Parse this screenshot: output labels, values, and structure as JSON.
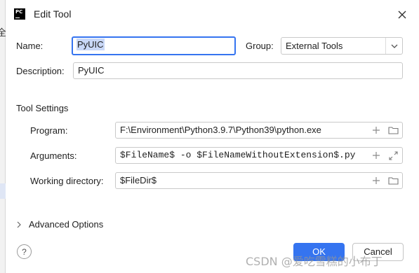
{
  "window": {
    "title": "Edit Tool",
    "app_icon_text": "PC"
  },
  "left_panel": {
    "glyph": "全"
  },
  "form": {
    "name_label": "Name:",
    "name_value": "PyUIC",
    "group_label": "Group:",
    "group_value": "External Tools",
    "description_label": "Description:",
    "description_value": "PyUIC"
  },
  "tool_settings": {
    "section_title": "Tool Settings",
    "program_label": "Program:",
    "program_value": "F:\\Environment\\Python3.9.7\\Python39\\python.exe",
    "arguments_label": "Arguments:",
    "arguments_value": "$FileName$ -o $FileNameWithoutExtension$.py",
    "workdir_label": "Working directory:",
    "workdir_value": "$FileDir$"
  },
  "advanced": {
    "label": "Advanced Options"
  },
  "footer": {
    "help_label": "?",
    "ok_label": "OK",
    "cancel_label": "Cancel"
  },
  "watermark": "CSDN @爱吃雪糕的小布丁",
  "colors": {
    "accent": "#3574f0",
    "selection": "#c9d8f7"
  }
}
